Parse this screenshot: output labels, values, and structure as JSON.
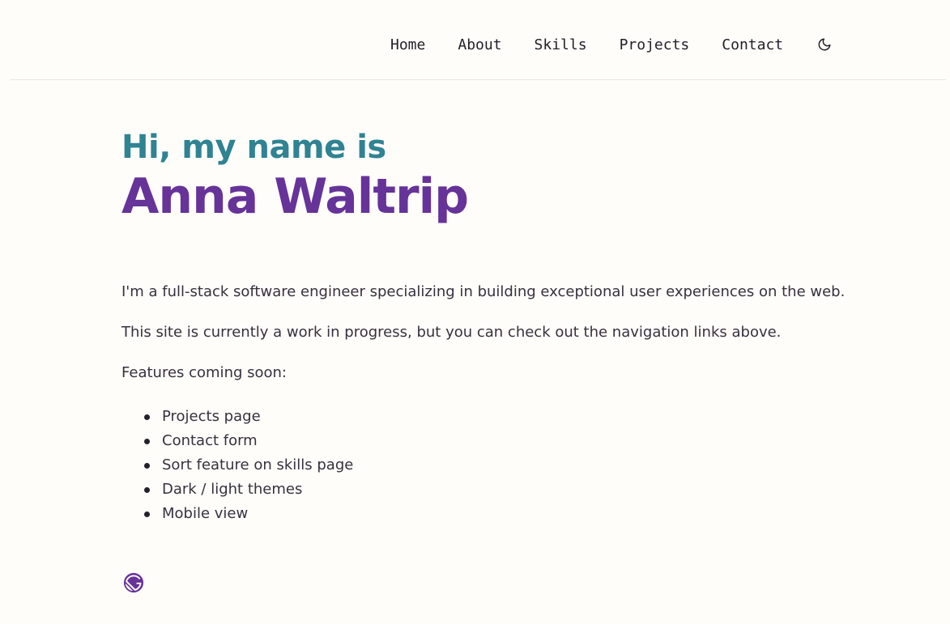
{
  "nav": {
    "links": [
      "Home",
      "About",
      "Skills",
      "Projects",
      "Contact"
    ],
    "theme_toggle_icon": "moon-icon"
  },
  "hero": {
    "intro": "Hi, my name is",
    "name": "Anna Waltrip"
  },
  "content": {
    "paragraph_1": "I'm a full-stack software engineer specializing in building exceptional user experiences on the web.",
    "paragraph_2": "This site is currently a work in progress, but you can check out the navigation links above.",
    "features_heading": "Features coming soon:",
    "features": [
      "Projects page",
      "Contact form",
      "Sort feature on skills page",
      "Dark / light themes",
      "Mobile view"
    ]
  },
  "footer": {
    "logo_icon": "gatsby-logo-icon"
  },
  "colors": {
    "accent_teal": "#2f8392",
    "accent_purple": "#663399",
    "text": "#36313d",
    "background": "#fffdfa"
  }
}
